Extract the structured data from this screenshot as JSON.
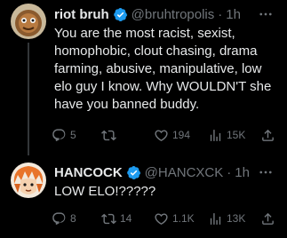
{
  "tweets": [
    {
      "display_name": "riot bruh",
      "handle": "@bruhtropolis",
      "separator": "·",
      "time": "1h",
      "text": "You are the most racist, sexist,\nhomophobic, clout chasing, drama\nfarming, abusive, manipulative, low\nelo guy I know. Why WOULDN'T she\nhave you banned buddy.",
      "replies": "5",
      "retweets": "",
      "likes": "194",
      "views": "15K"
    },
    {
      "display_name": "HANCOCK",
      "handle": "@HANCXCK",
      "separator": "·",
      "time": "1h",
      "text": "LOW ELO!?????",
      "replies": "8",
      "retweets": "14",
      "likes": "1.1K",
      "views": "13K"
    }
  ],
  "colors": {
    "background": "#000000",
    "text": "#e7e9ea",
    "secondary": "#71767b",
    "verified": "#1d9bf0",
    "thread_line": "#333639"
  },
  "icons": [
    "verified-badge-icon",
    "more-icon",
    "reply-icon",
    "retweet-icon",
    "like-icon",
    "views-icon",
    "share-icon"
  ]
}
